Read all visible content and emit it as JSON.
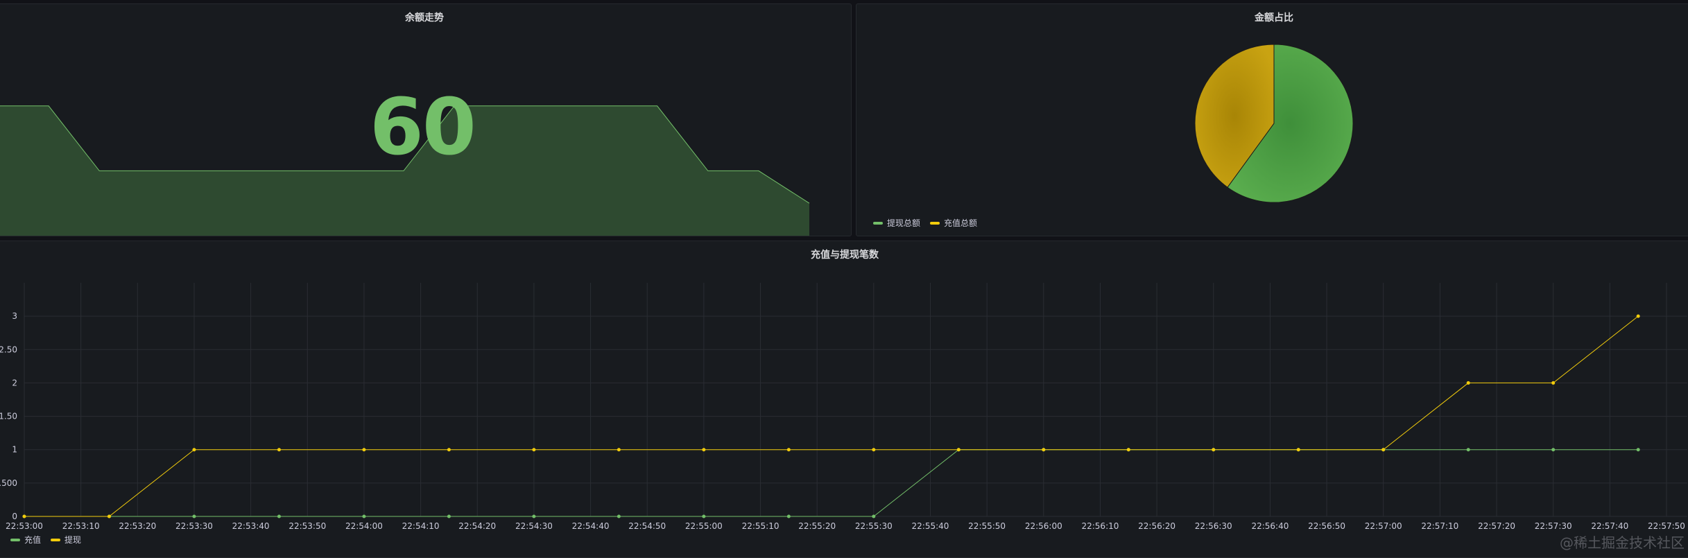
{
  "balance_panel": {
    "title": "余额走势",
    "value": "60",
    "color": "#73bf69",
    "sparkline": [
      40,
      40,
      20,
      20,
      20,
      20,
      20,
      20,
      20,
      40,
      40,
      40,
      40,
      40,
      20,
      20,
      10
    ]
  },
  "pie_panel": {
    "title": "金额占比",
    "legend": [
      {
        "label": "提现总额",
        "color": "#73bf69"
      },
      {
        "label": "充值总额",
        "color": "#f2cc0c"
      }
    ]
  },
  "counts_panel": {
    "title": "充值与提现笔数",
    "legend": [
      {
        "label": "充值",
        "color": "#73bf69"
      },
      {
        "label": "提现",
        "color": "#f2cc0c"
      }
    ]
  },
  "watermark": "@稀土掘金技术社区",
  "chart_data": [
    {
      "type": "pie",
      "title": "金额占比",
      "labels": [
        "提现总额",
        "充值总额"
      ],
      "values": [
        60,
        40
      ],
      "colors": [
        "#56a64b",
        "#c09b0c"
      ]
    },
    {
      "type": "line",
      "title": "充值与提现笔数",
      "x": [
        "22:53:00",
        "22:53:15",
        "22:53:30",
        "22:53:45",
        "22:54:00",
        "22:54:15",
        "22:54:30",
        "22:54:45",
        "22:55:00",
        "22:55:15",
        "22:55:30",
        "22:55:45",
        "22:56:00",
        "22:56:15",
        "22:56:30",
        "22:56:45",
        "22:57:00",
        "22:57:15",
        "22:57:30",
        "22:57:45"
      ],
      "series": [
        {
          "name": "充值",
          "color": "#73bf69",
          "values": [
            0,
            0,
            0,
            0,
            0,
            0,
            0,
            0,
            0,
            0,
            0,
            1,
            1,
            1,
            1,
            1,
            1,
            1,
            1,
            1
          ]
        },
        {
          "name": "提现",
          "color": "#f2cc0c",
          "values": [
            0,
            0,
            1,
            1,
            1,
            1,
            1,
            1,
            1,
            1,
            1,
            1,
            1,
            1,
            1,
            1,
            1,
            2,
            2,
            3
          ]
        }
      ],
      "x_ticks": [
        "22:53:00",
        "22:53:10",
        "22:53:20",
        "22:53:30",
        "22:53:40",
        "22:53:50",
        "22:54:00",
        "22:54:10",
        "22:54:20",
        "22:54:30",
        "22:54:40",
        "22:54:50",
        "22:55:00",
        "22:55:10",
        "22:55:20",
        "22:55:30",
        "22:55:40",
        "22:55:50",
        "22:56:00",
        "22:56:10",
        "22:56:20",
        "22:56:30",
        "22:56:40",
        "22:56:50",
        "22:57:00",
        "22:57:10",
        "22:57:20",
        "22:57:30",
        "22:57:40",
        "22:57:50"
      ],
      "y_ticks": [
        "0",
        "0.500",
        "1",
        "1.50",
        "2",
        "2.50",
        "3"
      ],
      "ylim": [
        0,
        3.5
      ],
      "grid": true,
      "legend": "bottom-left"
    }
  ]
}
